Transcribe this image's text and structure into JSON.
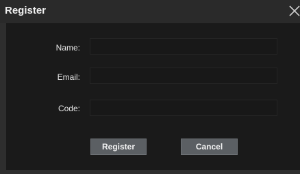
{
  "dialog": {
    "title": "Register",
    "close_icon": "close-icon"
  },
  "form": {
    "name_label": "Name:",
    "name_value": "",
    "email_label": "Email:",
    "email_value": "",
    "code_label": "Code:",
    "code_value": ""
  },
  "buttons": {
    "register_label": "Register",
    "cancel_label": "Cancel"
  },
  "colors": {
    "title_bar": "#2a2a2a",
    "panel": "#1a1a1a",
    "field": "#181818",
    "button": "#5b5f63",
    "text": "#f0f0f0"
  }
}
